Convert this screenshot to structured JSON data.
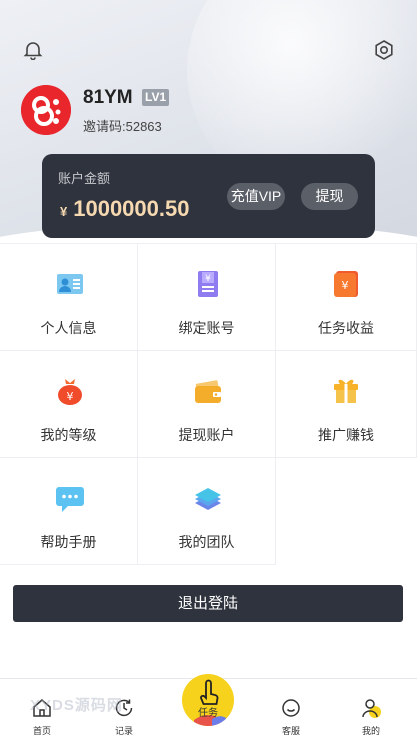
{
  "user": {
    "name": "81YM",
    "level": "LV1",
    "invite": "邀请码:52863"
  },
  "balance": {
    "label": "账户金额",
    "currency": "¥",
    "amount": "1000000.50",
    "recharge_label": "充值VIP",
    "withdraw_label": "提现"
  },
  "menu": [
    {
      "label": "个人信息",
      "icon": "profile-card-icon"
    },
    {
      "label": "绑定账号",
      "icon": "bind-account-icon"
    },
    {
      "label": "任务收益",
      "icon": "task-earnings-icon"
    },
    {
      "label": "我的等级",
      "icon": "money-bag-icon"
    },
    {
      "label": "提现账户",
      "icon": "wallet-icon"
    },
    {
      "label": "推广赚钱",
      "icon": "gift-icon"
    },
    {
      "label": "帮助手册",
      "icon": "chat-icon"
    },
    {
      "label": "我的团队",
      "icon": "layers-icon"
    }
  ],
  "logout_label": "退出登陆",
  "tabs": [
    {
      "label": "首页",
      "icon": "home-icon"
    },
    {
      "label": "记录",
      "icon": "record-icon"
    },
    {
      "label": "任务",
      "icon": "tap-hand-icon"
    },
    {
      "label": "客服",
      "icon": "service-icon"
    },
    {
      "label": "我的",
      "icon": "user-icon"
    }
  ],
  "watermark": "XYDS源码网",
  "colors": {
    "card_bg": "#2f333d",
    "amount_gold": "#f6d9b0",
    "accent_yellow": "#f6d21c",
    "avatar_red": "#e8262c"
  }
}
